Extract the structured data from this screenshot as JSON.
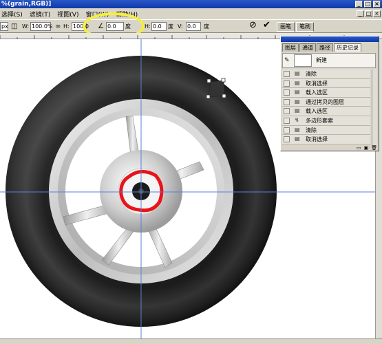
{
  "window": {
    "title": "%(grain,RGB)]",
    "controls": [
      "_",
      "□",
      "×"
    ]
  },
  "menu": {
    "items": [
      "选择(S)",
      "滤镜(T)",
      "视图(V)",
      "窗口(W)",
      "帮助(H)"
    ],
    "doc_controls": [
      "_",
      "□",
      "×"
    ]
  },
  "options": {
    "x_unit": "px",
    "w_label": "W:",
    "w_value": "100.0%",
    "h_label": "H:",
    "h_value": "100.0",
    "angle_value": "0.0",
    "angle_unit": "度",
    "h_skew_label": "H:",
    "h_skew_value": "0.0",
    "h_skew_unit": "度",
    "v_skew_label": "V:",
    "v_skew_value": "0.0",
    "v_skew_unit": "度"
  },
  "palette_well": {
    "tabs": [
      "画笔",
      "笔刷"
    ]
  },
  "history_panel": {
    "tabs": [
      "图层",
      "通道",
      "路径",
      "历史记录"
    ],
    "active_tab": "历史记录",
    "snapshot_label": "新建",
    "items": [
      "清除",
      "取消选择",
      "载入选区",
      "通过拷贝的图层",
      "载入选区",
      "多边形套索",
      "清除",
      "取消选择"
    ],
    "footer_icons": [
      "new-document-from-state",
      "camera",
      "trash"
    ]
  },
  "colors": {
    "annotation_yellow": "#f6ef3a",
    "annotation_red": "#e8141a",
    "guide_blue": "#5a7fd9",
    "title_blue": "#0e3aa8",
    "chrome": "#d8d4c8"
  }
}
